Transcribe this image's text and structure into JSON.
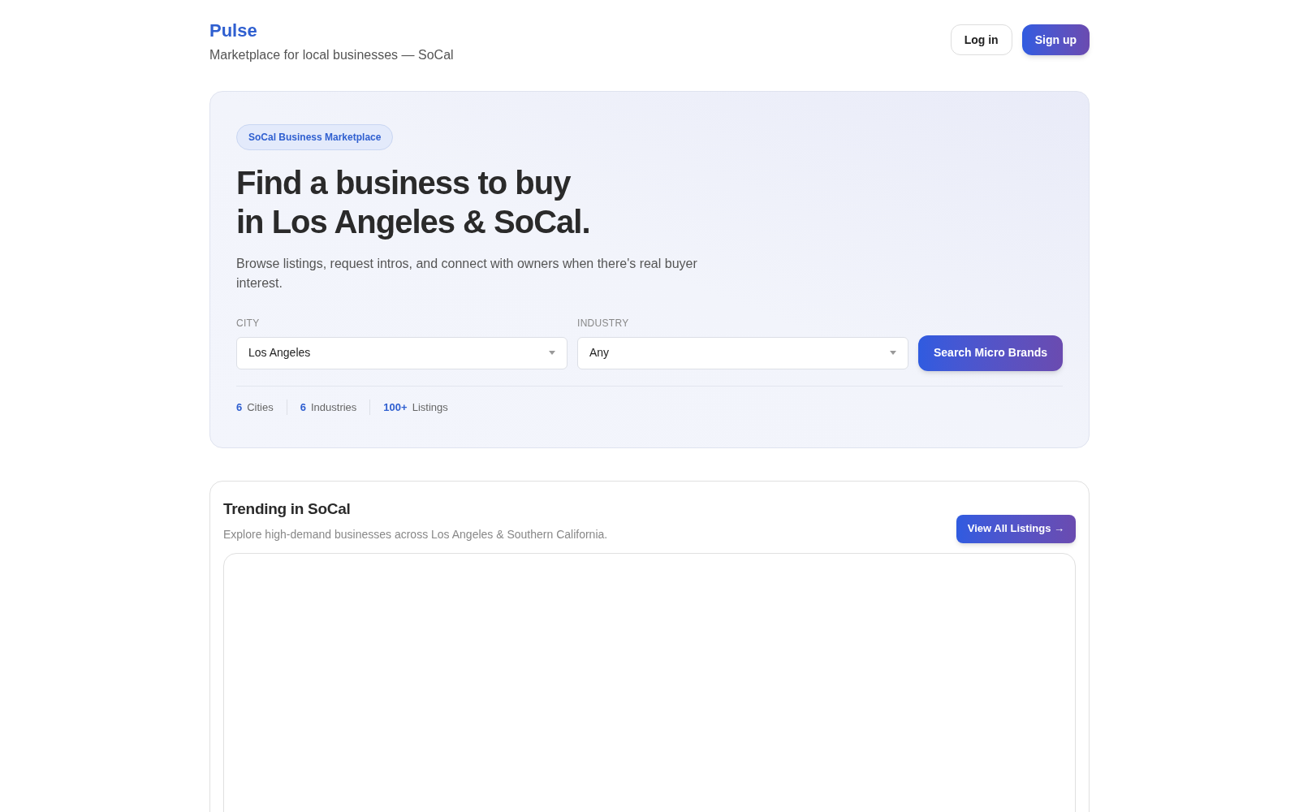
{
  "brand": {
    "name": "Pulse",
    "tagline": "Marketplace for local businesses — SoCal"
  },
  "nav": {
    "login": "Log in",
    "signup": "Sign up"
  },
  "hero": {
    "badge": "SoCal Business Marketplace",
    "title_lines": [
      "Find a business to buy",
      "in Los Angeles & SoCal."
    ],
    "description": "Browse listings, request intros, and connect with owners when there's real buyer interest.",
    "filters": [
      {
        "label": "CITY",
        "value": "Los Angeles"
      },
      {
        "label": "INDUSTRY",
        "value": "Any"
      }
    ],
    "search_button": "Search Micro Brands",
    "stats": [
      {
        "value": "6",
        "label": "Cities"
      },
      {
        "value": "6",
        "label": "Industries"
      },
      {
        "value": "100+",
        "label": "Listings"
      }
    ]
  },
  "trending": {
    "title": "Trending in SoCal",
    "subtitle": "Explore high-demand businesses across Los Angeles & Southern California.",
    "button": "View All Listings →"
  }
}
